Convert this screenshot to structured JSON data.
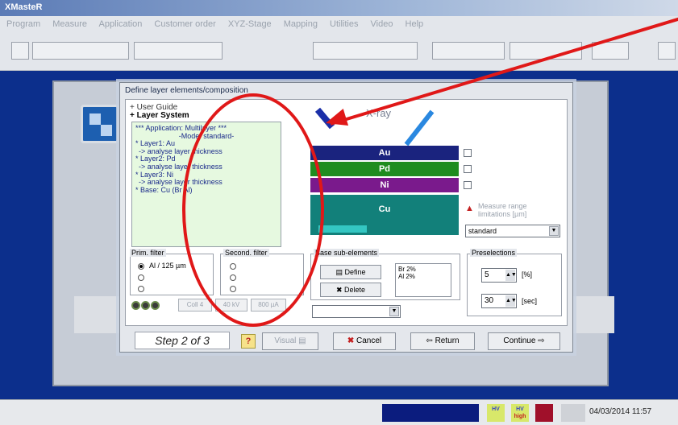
{
  "window": {
    "title": "XMasteR"
  },
  "menu": [
    "Program",
    "Measure",
    "Application",
    "Customer order",
    "XYZ-Stage",
    "Mapping",
    "Utilities",
    "Video",
    "Help"
  ],
  "dialog": {
    "title": "Define layer elements/composition",
    "guide": {
      "user_guide": "User Guide",
      "layer_system": "Layer System"
    },
    "composition_lines": [
      "*** Application: Multilayer ***",
      "-Mode: standard-",
      "* Layer1: Au",
      "-> analyse layer thickness",
      "* Layer2: Pd",
      "-> analyse layer thickness",
      "* Layer3: Ni",
      "-> analyse layer thickness",
      "* Base: Cu (Br Al)"
    ],
    "xray_label": "X-ray",
    "layers": [
      {
        "name": "Au",
        "color": "#1a237e"
      },
      {
        "name": "Pd",
        "color": "#1f8c1f"
      },
      {
        "name": "Ni",
        "color": "#7a1a8c"
      },
      {
        "name": "Cu",
        "color": "#12807a"
      }
    ],
    "measure_range": {
      "line1": "Measure range",
      "line2": "limitations [µm]"
    },
    "mode_select": "standard",
    "prim_filter": {
      "label": "Prim. filter",
      "options": [
        "Al / 125 µm",
        "",
        ""
      ]
    },
    "second_filter": {
      "label": "Second. filter"
    },
    "base_sub": {
      "label": "Base sub-elements",
      "define": "Define",
      "delete": "Delete",
      "elements": [
        "Br 2%",
        "Al 2%"
      ]
    },
    "preselections": {
      "label": "Preselections",
      "percent_value": "5",
      "percent_unit": "[%]",
      "sec_value": "30",
      "sec_unit": "[sec]"
    },
    "status": {
      "coll": "Coll 4",
      "kv": "40 kV",
      "ua": "800 µA"
    },
    "footer": {
      "step": "Step 2 of 3",
      "help": "?",
      "visual": "Visual",
      "cancel": "Cancel",
      "return": "Return",
      "continue": "Continue"
    }
  },
  "statusbar": {
    "icon_hv": "HV",
    "icon_hv_high_top": "HV",
    "icon_hv_high_bottom": "high",
    "datetime": "04/03/2014 11:57"
  },
  "colors": {
    "annotation": "#e01818",
    "workspace": "#0c2f8c"
  }
}
